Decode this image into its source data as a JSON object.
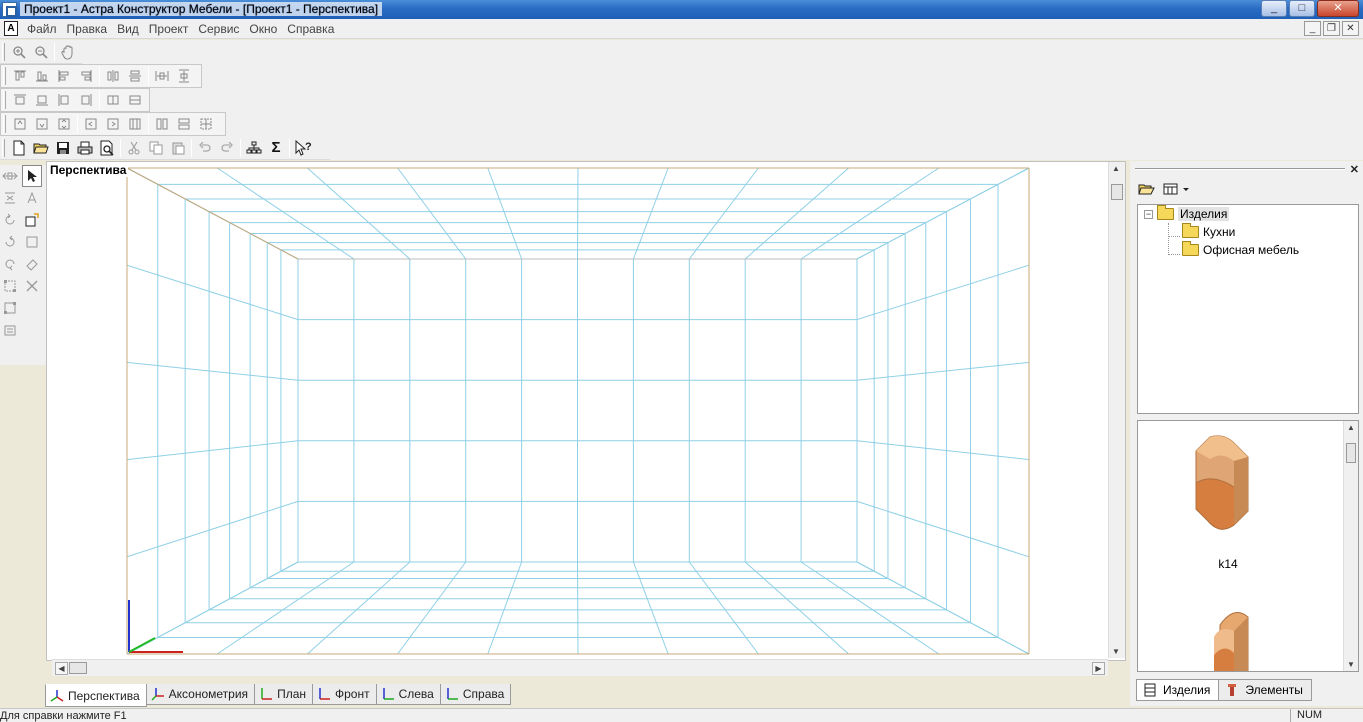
{
  "window": {
    "title": "Проект1 - Астра Конструктор Мебели - [Проект1 - Перспектива]",
    "controls": {
      "minimize": "_",
      "maximize": "□",
      "close": "✕"
    }
  },
  "menu": {
    "items": [
      "Файл",
      "Правка",
      "Вид",
      "Проект",
      "Сервис",
      "Окно",
      "Справка"
    ],
    "mdi_controls": {
      "minimize": "_",
      "restore": "❐",
      "close": "✕"
    }
  },
  "toolbars": {
    "row1": [
      "zoom-in-icon",
      "zoom-out-icon",
      "pan-hand-icon"
    ],
    "row2": [
      "align-top-icon",
      "align-bottom-icon",
      "align-left-icon",
      "align-right-icon",
      "align-center-h-icon",
      "align-center-v-icon",
      "distribute-h-icon",
      "distribute-v-icon"
    ],
    "row3": [
      "snap-top-icon",
      "snap-bottom-icon",
      "snap-left-icon",
      "snap-right-icon",
      "fit-width-icon",
      "fit-height-icon"
    ],
    "row4": [
      "place-top-icon",
      "place-bottom-icon",
      "place-stack-icon",
      "place-left-icon",
      "place-right-icon",
      "place-columns-icon",
      "place-split-icon",
      "place-rows-icon",
      "place-grid-icon"
    ],
    "row5": [
      "new-file-icon",
      "open-folder-icon",
      "save-icon",
      "print-icon",
      "print-preview-icon",
      "cut-icon",
      "copy-icon",
      "paste-icon",
      "undo-icon",
      "redo-icon",
      "structure-icon",
      "sum-icon",
      "help-cursor-icon"
    ]
  },
  "view": {
    "label": "Перспектива",
    "grid_color": "#8fd0e6",
    "frame_color": "#c8a97a"
  },
  "view_tabs": [
    {
      "label": "Перспектива",
      "active": true
    },
    {
      "label": "Аксонометрия",
      "active": false
    },
    {
      "label": "План",
      "active": false
    },
    {
      "label": "Фронт",
      "active": false
    },
    {
      "label": "Слева",
      "active": false
    },
    {
      "label": "Справа",
      "active": false
    }
  ],
  "library": {
    "tree": {
      "root": "Изделия",
      "children": [
        "Кухни",
        "Офисная мебель"
      ]
    },
    "gallery": {
      "items": [
        {
          "label": "k14"
        }
      ]
    },
    "tabs": [
      {
        "label": "Изделия",
        "active": true
      },
      {
        "label": "Элементы",
        "active": false
      }
    ]
  },
  "status": {
    "message": "Для справки нажмите F1",
    "indicator": "NUM"
  }
}
